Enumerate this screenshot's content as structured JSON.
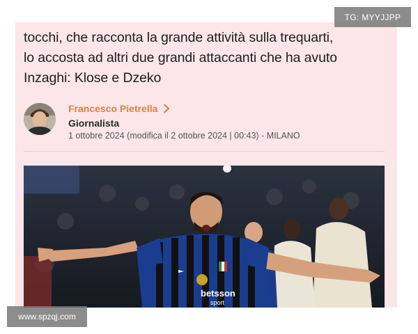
{
  "article": {
    "lead_lines": [
      "tocchi, che racconta la grande attività sulla trequarti,",
      "lo accosta ad altri due grandi attaccanti che ha avuto",
      "Inzaghi: Klose e Dzeko"
    ]
  },
  "author": {
    "name": "Francesco Pietrella",
    "role": "Giornalista",
    "date": "1 ottobre 2024 (modifica il 2 ottobre 2024 | 00:43) - MILANO"
  },
  "photo": {
    "shirt_sponsor_top": "betsson",
    "shirt_sponsor_bottom": "sport"
  },
  "watermarks": {
    "top": "TG: MYYJJPP",
    "bottom": "www.spzqj.com"
  },
  "colors": {
    "card_background": "#fce6ea",
    "author_accent": "#d9823c",
    "inter_blue": "#1a3d8f",
    "stadium_dark": "#1f2530"
  }
}
